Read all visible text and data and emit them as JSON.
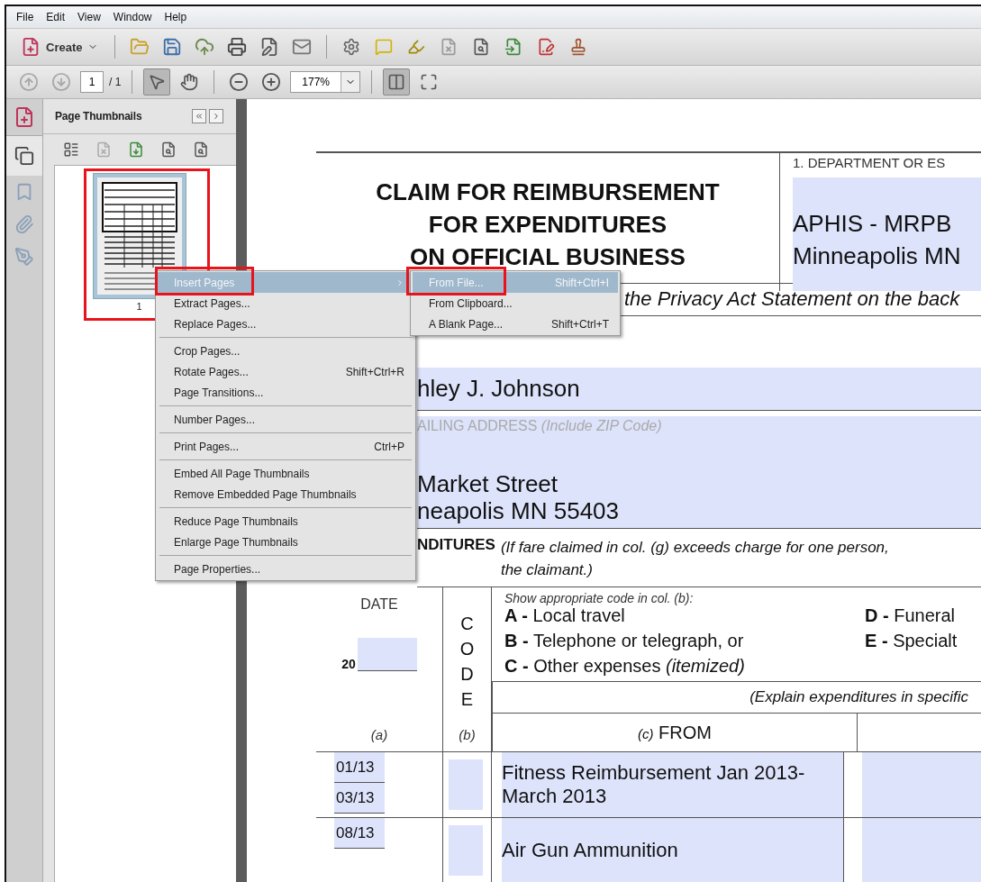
{
  "menu_bar": [
    "File",
    "Edit",
    "View",
    "Window",
    "Help"
  ],
  "toolbar": {
    "create_label": "Create"
  },
  "navigation": {
    "buttons": [
      {
        "kind": "previous",
        "disabled": true
      },
      {
        "kind": "next",
        "disabled": true
      }
    ],
    "page": "1",
    "page_count": "/ 1",
    "tools": [
      {
        "kind": "select",
        "selected": true
      },
      {
        "kind": "hand",
        "selected": false
      }
    ],
    "zoom": "177%",
    "view_modes": [
      {
        "kind": "fit_page",
        "selected": true
      },
      {
        "kind": "fit_width",
        "selected": false
      }
    ]
  },
  "side_tabs": [
    {
      "kind": "pages",
      "selected": true
    },
    {
      "kind": "bookmarks",
      "selected": false
    },
    {
      "kind": "attachments",
      "selected": false
    },
    {
      "kind": "signatures",
      "selected": false
    }
  ],
  "thumbnails_panel": {
    "title": "Page Thumbnails",
    "thumbnails": [
      {
        "label": "1",
        "selected": true
      }
    ]
  },
  "context_menu": {
    "groups": [
      [
        {
          "label": "Insert Pages",
          "submenu": true,
          "selected": true
        },
        {
          "label": "Extract Pages...",
          "submenu": false,
          "selected": false
        },
        {
          "label": "Replace Pages...",
          "submenu": false,
          "selected": false
        }
      ],
      [
        {
          "label": "Crop Pages...",
          "submenu": false,
          "selected": false
        },
        {
          "label": "Rotate Pages...",
          "shortcut": "Shift+Ctrl+R",
          "submenu": false,
          "selected": false
        },
        {
          "label": "Page Transitions...",
          "submenu": false,
          "selected": false
        }
      ],
      [
        {
          "label": "Number Pages...",
          "submenu": false,
          "selected": false
        }
      ],
      [
        {
          "label": "Print Pages...",
          "shortcut": "Ctrl+P",
          "submenu": false,
          "selected": false
        }
      ],
      [
        {
          "label": "Embed All Page Thumbnails",
          "submenu": false,
          "selected": false
        },
        {
          "label": "Remove Embedded Page Thumbnails",
          "submenu": false,
          "selected": false
        }
      ],
      [
        {
          "label": "Reduce Page Thumbnails",
          "submenu": false,
          "selected": false
        },
        {
          "label": "Enlarge Page Thumbnails",
          "submenu": false,
          "selected": false
        }
      ],
      [
        {
          "label": "Page Properties...",
          "submenu": false,
          "selected": false
        }
      ]
    ]
  },
  "submenu": {
    "items": [
      {
        "label": "From File...",
        "shortcut": "Shift+Ctrl+I",
        "selected": true
      },
      {
        "label": "From Clipboard...",
        "selected": false
      },
      {
        "label": "A Blank Page...",
        "shortcut": "Shift+Ctrl+T",
        "selected": false
      }
    ]
  },
  "document": {
    "title_lines": [
      "CLAIM FOR REIMBURSEMENT",
      "FOR EXPENDITURES",
      "ON OFFICIAL BUSINESS"
    ],
    "department_label": "1.  DEPARTMENT OR ES",
    "department_lines": [
      "APHIS - MRPB",
      "Minneapolis MN"
    ],
    "privacy_note": "the Privacy Act Statement on the back",
    "name_value": "hley J. Johnson",
    "address_label": "AILING ADDRESS",
    "address_hint": "(Include ZIP Code)",
    "address_lines": [
      "Market Street",
      "neapolis MN 55403"
    ],
    "expenditures_heading": "NDITURES",
    "expenditures_note": [
      "(If fare claimed in col. (g) exceeds charge for one person,",
      "the claimant.)"
    ],
    "date_header": "DATE",
    "year_prefix": "20",
    "code_letters": [
      "C",
      "O",
      "D",
      "E"
    ],
    "code_hint": "Show appropriate code in col. (b):",
    "codes": [
      {
        "letter": "A -",
        "text": "Local travel"
      },
      {
        "letter": "B -",
        "text": "Telephone or telegraph, or"
      },
      {
        "letter": "C -",
        "text": "Other expenses",
        "note": "(itemized)"
      },
      {
        "letter": "D -",
        "text": "Funeral"
      },
      {
        "letter": "E -",
        "text": "Specialt"
      }
    ],
    "explain_note": "(Explain expenditures in specific",
    "column_labels": [
      "(a)",
      "(b)"
    ],
    "from_label": "(c)",
    "from_header": "FROM",
    "rows": [
      {
        "dates": [
          "01/13",
          "03/13"
        ],
        "description": "Fitness Reimbursement Jan 2013-March 2013"
      },
      {
        "dates": [
          "08/13"
        ],
        "description": "Air Gun Ammunition"
      }
    ]
  }
}
